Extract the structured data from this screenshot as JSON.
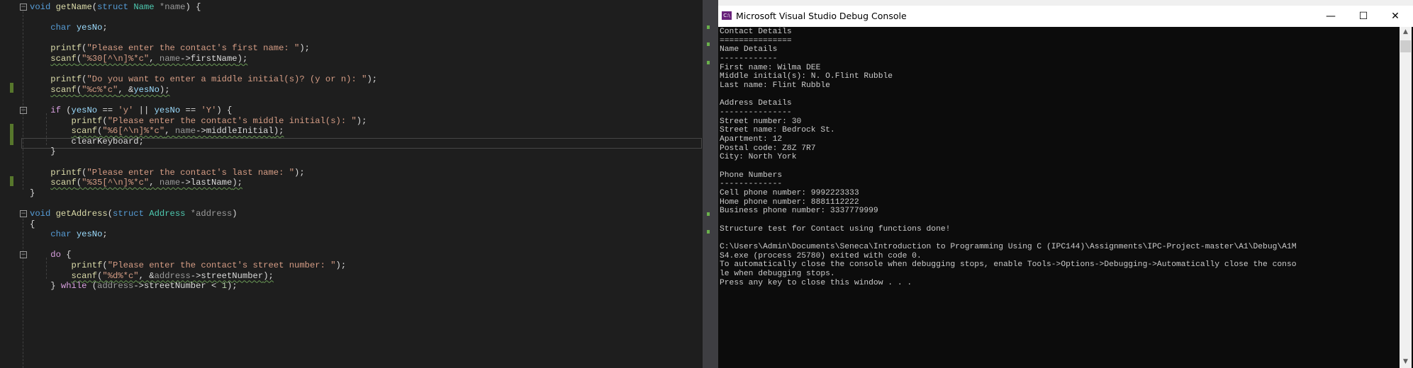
{
  "editor": {
    "lines": [
      {
        "tokens": [
          [
            "void ",
            "kw"
          ],
          [
            "getName",
            "fn"
          ],
          [
            "(",
            "df"
          ],
          [
            "struct ",
            "kw"
          ],
          [
            "Name ",
            "ty"
          ],
          [
            "*name",
            "pa"
          ],
          [
            ") {",
            "df"
          ]
        ]
      },
      {
        "tokens": []
      },
      {
        "tokens": [
          [
            "    ",
            "ws"
          ],
          [
            "char ",
            "kw"
          ],
          [
            "yesNo",
            "lv"
          ],
          [
            ";",
            "df"
          ]
        ]
      },
      {
        "tokens": []
      },
      {
        "tokens": [
          [
            "    ",
            "ws"
          ],
          [
            "printf",
            "fn"
          ],
          [
            "(",
            "df"
          ],
          [
            "\"Please enter the contact's first name: \"",
            "st"
          ],
          [
            ");",
            "df"
          ]
        ]
      },
      {
        "squiggle": true,
        "tokens": [
          [
            "    ",
            "ws"
          ],
          [
            "scanf",
            "fn"
          ],
          [
            "(",
            "df"
          ],
          [
            "\"%30[^\\n]%*c\"",
            "st"
          ],
          [
            ", ",
            "df"
          ],
          [
            "name",
            "pa"
          ],
          [
            "->",
            "df"
          ],
          [
            "firstName",
            "mb"
          ],
          [
            ");",
            "df"
          ]
        ]
      },
      {
        "tokens": []
      },
      {
        "tokens": [
          [
            "    ",
            "ws"
          ],
          [
            "printf",
            "fn"
          ],
          [
            "(",
            "df"
          ],
          [
            "\"Do you want to enter a middle initial(s)? (y or n): \"",
            "st"
          ],
          [
            ");",
            "df"
          ]
        ]
      },
      {
        "squiggle": true,
        "tokens": [
          [
            "    ",
            "ws"
          ],
          [
            "scanf",
            "fn"
          ],
          [
            "(",
            "df"
          ],
          [
            "\"%c%*c\"",
            "st"
          ],
          [
            ", &",
            "df"
          ],
          [
            "yesNo",
            "lv"
          ],
          [
            ");",
            "df"
          ]
        ]
      },
      {
        "tokens": []
      },
      {
        "tokens": [
          [
            "    ",
            "ws"
          ],
          [
            "if ",
            "ct"
          ],
          [
            "(",
            "df"
          ],
          [
            "yesNo",
            "lv"
          ],
          [
            " == ",
            "df"
          ],
          [
            "'y'",
            "st"
          ],
          [
            " || ",
            "df"
          ],
          [
            "yesNo",
            "lv"
          ],
          [
            " == ",
            "df"
          ],
          [
            "'Y'",
            "st"
          ],
          [
            ") {",
            "df"
          ]
        ]
      },
      {
        "tokens": [
          [
            "        ",
            "ws"
          ],
          [
            "printf",
            "fn"
          ],
          [
            "(",
            "df"
          ],
          [
            "\"Please enter the contact's middle initial(s): \"",
            "st"
          ],
          [
            ");",
            "df"
          ]
        ]
      },
      {
        "squiggle": true,
        "tokens": [
          [
            "        ",
            "ws"
          ],
          [
            "scanf",
            "fn"
          ],
          [
            "(",
            "df"
          ],
          [
            "\"%6[^\\n]%*c\"",
            "st"
          ],
          [
            ", ",
            "df"
          ],
          [
            "name",
            "pa"
          ],
          [
            "->",
            "df"
          ],
          [
            "middleInitial",
            "mb"
          ],
          [
            ");",
            "df"
          ]
        ]
      },
      {
        "tokens": [
          [
            "        ",
            "ws"
          ],
          [
            "clearKeyboard",
            "df"
          ],
          [
            ";",
            "df"
          ]
        ]
      },
      {
        "tokens": [
          [
            "    ",
            "ws"
          ],
          [
            "}",
            "df"
          ]
        ]
      },
      {
        "tokens": []
      },
      {
        "tokens": [
          [
            "    ",
            "ws"
          ],
          [
            "printf",
            "fn"
          ],
          [
            "(",
            "df"
          ],
          [
            "\"Please enter the contact's last name: \"",
            "st"
          ],
          [
            ");",
            "df"
          ]
        ]
      },
      {
        "squiggle": true,
        "tokens": [
          [
            "    ",
            "ws"
          ],
          [
            "scanf",
            "fn"
          ],
          [
            "(",
            "df"
          ],
          [
            "\"%35[^\\n]%*c\"",
            "st"
          ],
          [
            ", ",
            "df"
          ],
          [
            "name",
            "pa"
          ],
          [
            "->",
            "df"
          ],
          [
            "lastName",
            "mb"
          ],
          [
            ");",
            "df"
          ]
        ]
      },
      {
        "tokens": [
          [
            "}",
            "df"
          ]
        ]
      },
      {
        "tokens": []
      },
      {
        "tokens": [
          [
            "void ",
            "kw"
          ],
          [
            "getAddress",
            "fn"
          ],
          [
            "(",
            "df"
          ],
          [
            "struct ",
            "kw"
          ],
          [
            "Address ",
            "ty"
          ],
          [
            "*address",
            "pa"
          ],
          [
            ")",
            "df"
          ]
        ]
      },
      {
        "tokens": [
          [
            "{",
            "df"
          ]
        ]
      },
      {
        "tokens": [
          [
            "    ",
            "ws"
          ],
          [
            "char ",
            "kw"
          ],
          [
            "yesNo",
            "lv"
          ],
          [
            ";",
            "df"
          ]
        ]
      },
      {
        "tokens": []
      },
      {
        "tokens": [
          [
            "    ",
            "ws"
          ],
          [
            "do ",
            "ct"
          ],
          [
            "{",
            "df"
          ]
        ]
      },
      {
        "tokens": [
          [
            "        ",
            "ws"
          ],
          [
            "printf",
            "fn"
          ],
          [
            "(",
            "df"
          ],
          [
            "\"Please enter the contact's street number: \"",
            "st"
          ],
          [
            ");",
            "df"
          ]
        ]
      },
      {
        "squiggle": true,
        "tokens": [
          [
            "        ",
            "ws"
          ],
          [
            "scanf",
            "fn"
          ],
          [
            "(",
            "df"
          ],
          [
            "\"%d%*c\"",
            "st"
          ],
          [
            ", &",
            "df"
          ],
          [
            "address",
            "pa"
          ],
          [
            "->",
            "df"
          ],
          [
            "streetNumber",
            "mb"
          ],
          [
            ");",
            "df"
          ]
        ]
      },
      {
        "tokens": [
          [
            "    ",
            "ws"
          ],
          [
            "} ",
            "df"
          ],
          [
            "while ",
            "ct"
          ],
          [
            "(",
            "df"
          ],
          [
            "address",
            "pa"
          ],
          [
            "->",
            "df"
          ],
          [
            "streetNumber",
            "mb"
          ],
          [
            " < ",
            "df"
          ],
          [
            "1",
            "nu"
          ],
          [
            ");",
            "df"
          ]
        ]
      }
    ]
  },
  "console": {
    "icon_label": "C:\\",
    "title": "Microsoft Visual Studio Debug Console",
    "minimize": "—",
    "maximize": "☐",
    "close": "✕",
    "lines": [
      "Contact Details",
      "===============",
      "Name Details",
      "------------",
      "First name: Wilma DEE",
      "Middle initial(s): N. O.Flint Rubble",
      "Last name: Flint Rubble",
      "",
      "Address Details",
      "---------------",
      "Street number: 30",
      "Street name: Bedrock St.",
      "Apartment: 12",
      "Postal code: Z8Z 7R7",
      "City: North York",
      "",
      "Phone Numbers",
      "-------------",
      "Cell phone number: 9992223333",
      "Home phone number: 8881112222",
      "Business phone number: 3337779999",
      "",
      "Structure test for Contact using functions done!",
      "",
      "C:\\Users\\Admin\\Documents\\Seneca\\Introduction to Programming Using C (IPC144)\\Assignments\\IPC-Project-master\\A1\\Debug\\A1M",
      "S4.exe (process 25780) exited with code 0.",
      "To automatically close the console when debugging stops, enable Tools->Options->Debugging->Automatically close the conso",
      "le when debugging stops.",
      "Press any key to close this window . . ."
    ]
  }
}
